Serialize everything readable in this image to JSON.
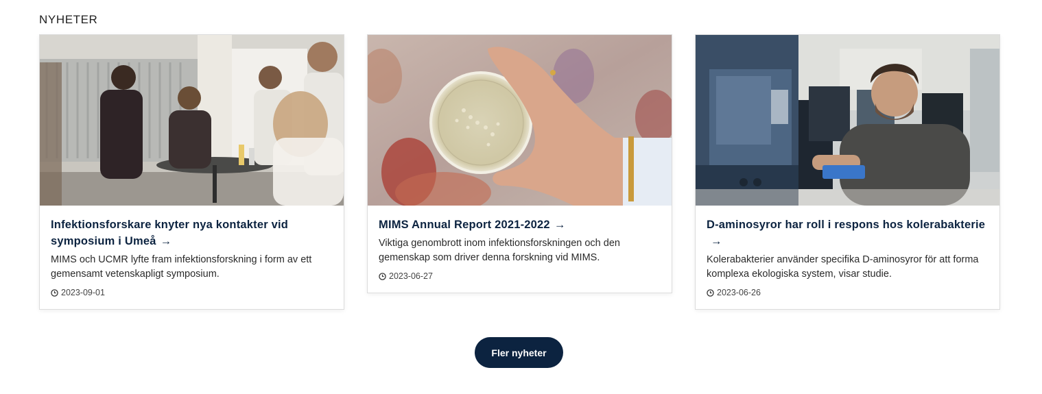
{
  "section": {
    "title": "NYHETER"
  },
  "cards": [
    {
      "title": "Infektionsforskare knyter nya kontakter vid symposium i Umeå",
      "arrow": "→",
      "excerpt": "MIMS och UCMR lyfte fram infektionsforskning i form av ett gemensamt vetenskapligt symposium.",
      "date": "2023-09-01",
      "image_icon": "people-at-symposium-photo"
    },
    {
      "title": "MIMS Annual Report 2021-2022",
      "arrow": "→",
      "excerpt": "Viktiga genombrott inom infektionsforskningen och den gemenskap som driver denna forskning vid MIMS.",
      "date": "2023-06-27",
      "image_icon": "petri-dish-photo"
    },
    {
      "title": "D-aminosyror har roll i respons hos kolerabakterie",
      "arrow": "→",
      "excerpt": "Kolerabakterier använder specifika D-aminosyror för att forma komplexa ekologiska system, visar studie.",
      "date": "2023-06-26",
      "image_icon": "researcher-in-lab-photo"
    }
  ],
  "more_button": {
    "label": "Fler nyheter"
  },
  "colors": {
    "accent": "#0c2340",
    "card_border": "#dcdcdc"
  }
}
